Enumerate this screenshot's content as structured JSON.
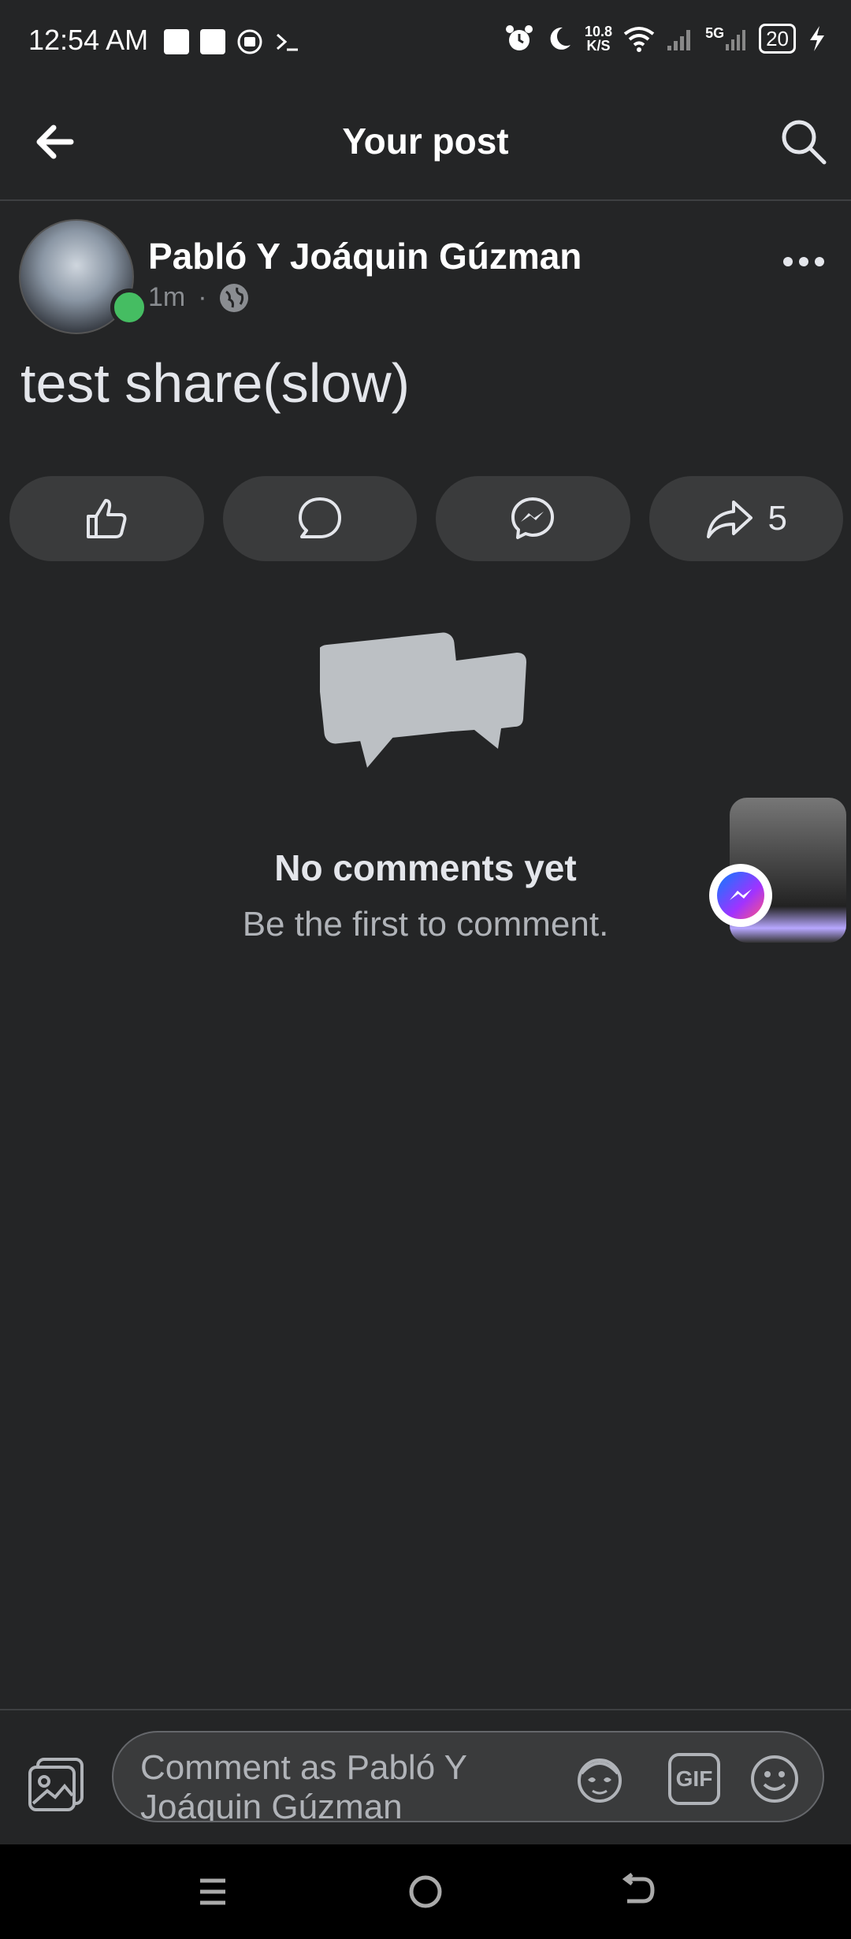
{
  "status_bar": {
    "time": "12:54 AM",
    "net_speed_value": "10.8",
    "net_speed_unit": "K/S",
    "network_type": "5G",
    "battery": "20"
  },
  "header": {
    "title": "Your post"
  },
  "post": {
    "author": "Pabló Y Joáquin Gúzman",
    "time": "1m",
    "separator": "·",
    "privacy_icon": "globe-icon",
    "text": "test share(slow)"
  },
  "actions": {
    "like_icon": "thumbs-up-icon",
    "comment_icon": "comment-icon",
    "messenger_icon": "messenger-icon",
    "share_icon": "share-icon",
    "share_count": "5"
  },
  "empty_state": {
    "title": "No comments yet",
    "subtitle": "Be the first to comment."
  },
  "comment_bar": {
    "placeholder": "Comment as Pabló Y Joáquin Gúzman",
    "avatar_icon": "avatar-sticker-icon",
    "gif_label": "GIF",
    "emoji_icon": "smiley-icon"
  },
  "colors": {
    "background": "#242526",
    "surface": "#3a3b3c",
    "online": "#45bd62",
    "text_primary": "#e4e6eb",
    "text_secondary": "#b0b3b8"
  }
}
